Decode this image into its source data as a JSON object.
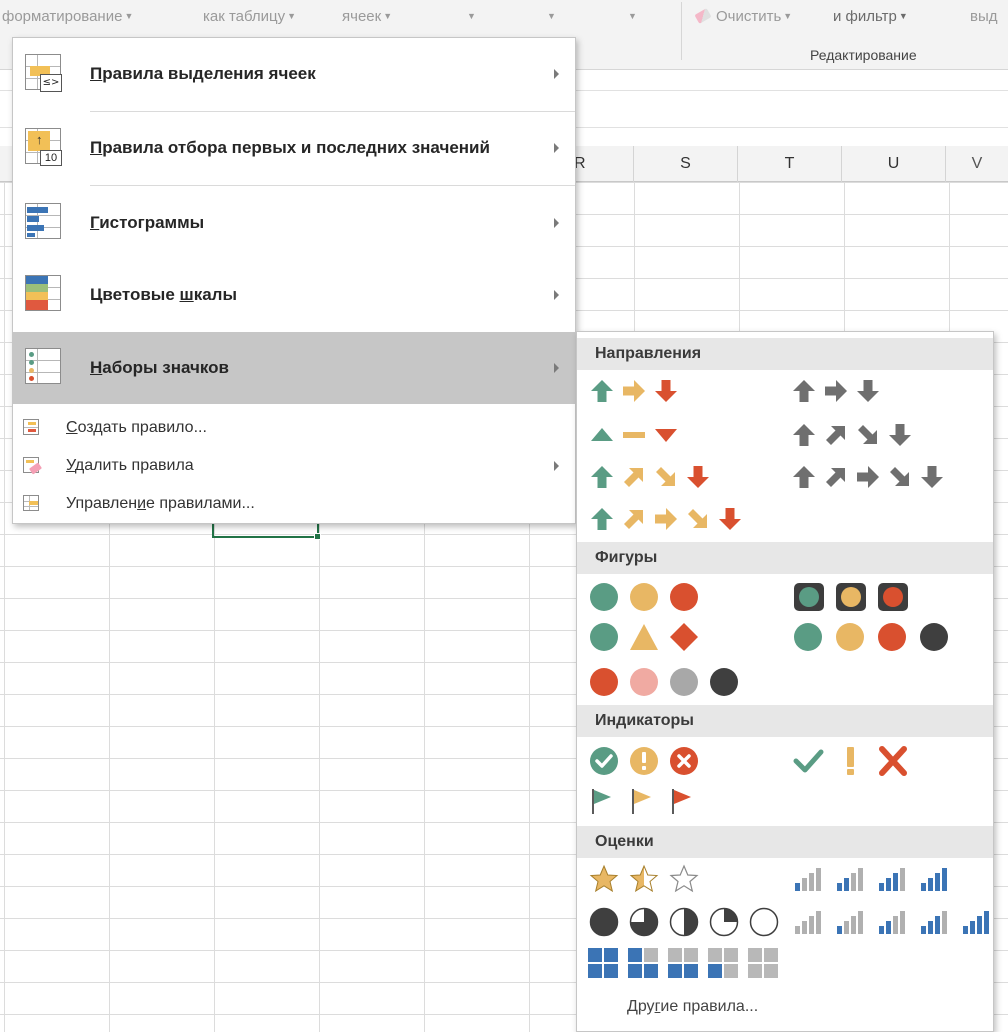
{
  "ribbon": {
    "btn_format": "форматирование",
    "btn_table": "как таблицу",
    "btn_cells": "ячеек",
    "btn_clear": "Очистить",
    "btn_filter": "и фильтр",
    "btn_select": "выд",
    "group_label": "Редактирование"
  },
  "columns": [
    "R",
    "S",
    "T",
    "U",
    "V"
  ],
  "main_menu": {
    "items": [
      {
        "label_first": "П",
        "label_rest": "равила выделения ячеек"
      },
      {
        "label_first": "П",
        "label_rest": "равила отбора первых и последних значений"
      },
      {
        "label_first": "Г",
        "label_rest": "истограммы"
      },
      {
        "label_first": "Цветовые ",
        "label_ul": "ш",
        "label_rest": "калы"
      },
      {
        "label_first": "Н",
        "label_rest": "аборы значков"
      }
    ],
    "icon_10": "10",
    "icon_le": "≤>",
    "small_items": [
      {
        "label_ul": "С",
        "label_rest": "оздать правило..."
      },
      {
        "label_ul": "У",
        "label_rest": "далить правила"
      },
      {
        "label_first": "Управлен",
        "label_ul": "и",
        "label_rest": "е правилами..."
      }
    ]
  },
  "submenu": {
    "sections": [
      "Направления",
      "Фигуры",
      "Индикаторы",
      "Оценки"
    ],
    "more_rules_first": "Дру",
    "more_rules_ul": "г",
    "more_rules_rest": "ие правила..."
  },
  "colors": {
    "green": "#5a9c84",
    "yellow": "#e8b764",
    "red": "#d9502f",
    "gray": "#6f6f6f",
    "dark": "#3f3f3f",
    "blue": "#3b74b5",
    "highlight": "#c6c6c6"
  }
}
